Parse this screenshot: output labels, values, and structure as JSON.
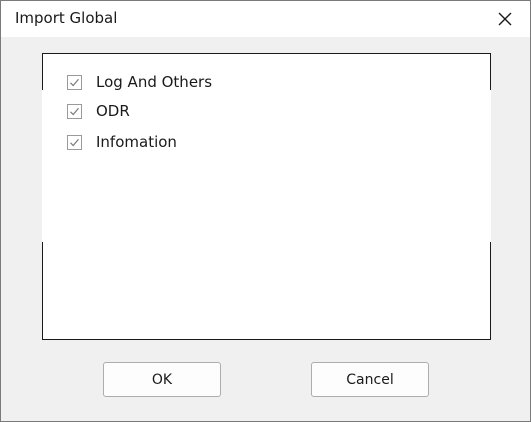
{
  "window": {
    "title": "Import Global"
  },
  "options": [
    {
      "label": "Log And Others",
      "checked": true
    },
    {
      "label": "ODR",
      "checked": true
    },
    {
      "label": "Infomation",
      "checked": true
    }
  ],
  "buttons": {
    "ok_label": "OK",
    "cancel_label": "Cancel"
  },
  "icons": {
    "close": "close-icon",
    "check": "checkmark-icon"
  },
  "colors": {
    "dialog_background": "#f0f0f0",
    "title_bar": "#ffffff",
    "panel_border": "#1a1a1a",
    "checkmark": "#7a7a7a"
  }
}
